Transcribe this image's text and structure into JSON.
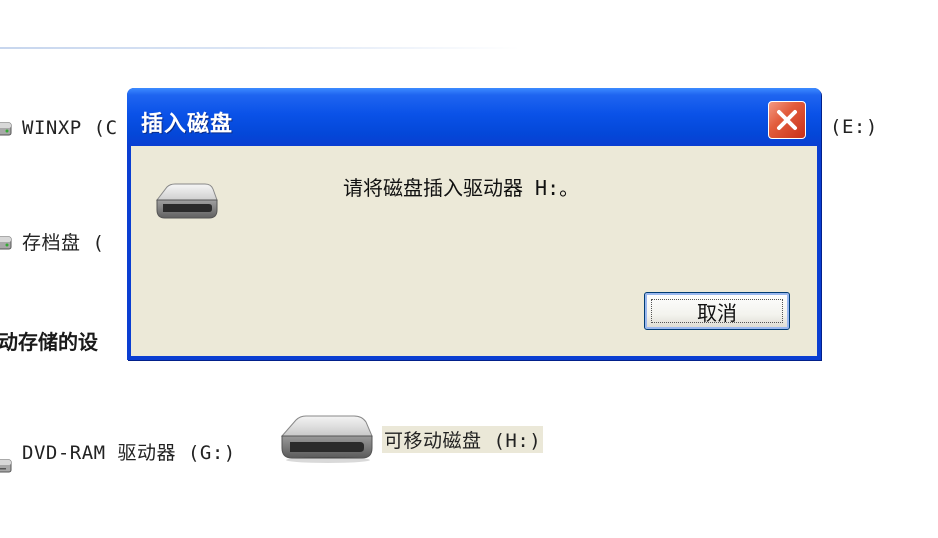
{
  "window": {
    "drives": [
      {
        "label": "WINXP (C"
      },
      {
        "label": "(E:)"
      },
      {
        "label": "存档盘 ("
      }
    ],
    "section_title": "动存储的设",
    "removable": [
      {
        "label": "DVD-RAM 驱动器 (G:)"
      },
      {
        "label": "可移动磁盘 (H:)"
      }
    ]
  },
  "dialog": {
    "title": "插入磁盘",
    "message": "请将磁盘插入驱动器 H:。",
    "cancel_label": "取消",
    "close_icon": "close-icon",
    "drive_icon": "removable-disk-icon"
  },
  "colors": {
    "titlebar": "#0a52e8",
    "close_button": "#e25c3c",
    "dialog_body": "#ece9d8",
    "selection_highlight": "#ebe8d8"
  }
}
